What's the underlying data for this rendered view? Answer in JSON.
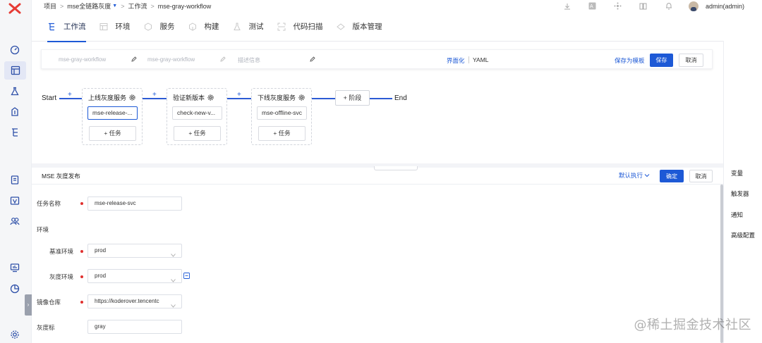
{
  "breadcrumb": {
    "project_label": "项目",
    "project_name": "mse全链路灰度",
    "section": "工作流",
    "workflow": "mse-gray-workflow"
  },
  "user": {
    "name": "admin(admin)"
  },
  "tabs": [
    {
      "label": "工作流",
      "icon": "workflow-icon"
    },
    {
      "label": "环境",
      "icon": "environment-icon"
    },
    {
      "label": "服务",
      "icon": "service-icon"
    },
    {
      "label": "构建",
      "icon": "build-icon"
    },
    {
      "label": "测试",
      "icon": "test-icon"
    },
    {
      "label": "代码扫描",
      "icon": "scan-icon"
    },
    {
      "label": "版本管理",
      "icon": "version-icon"
    }
  ],
  "workflow_header": {
    "name_placeholder": "mse-gray-workflow",
    "display_name_placeholder": "mse-gray-workflow",
    "description_placeholder": "描述信息",
    "mode_ui": "界面化",
    "mode_yaml": "YAML",
    "save_as_template": "保存为模板",
    "save": "保存",
    "cancel": "取消"
  },
  "pipeline": {
    "start": "Start",
    "end": "End",
    "add_stage": "+ 阶段",
    "add_task": "+ 任务",
    "plus": "+",
    "stages": [
      {
        "name": "上线灰度服务",
        "job": "mse-release-..."
      },
      {
        "name": "验证新版本",
        "job": "check-new-v..."
      },
      {
        "name": "下线灰度服务",
        "job": "mse-offline-svc"
      }
    ]
  },
  "task_panel": {
    "title": "MSE 灰度发布",
    "run_policy": "默认执行",
    "confirm": "确定",
    "cancel": "取消",
    "fields": {
      "task_name_label": "任务名称",
      "task_name_value": "mse-release-svc",
      "env_section": "环境",
      "base_env_label": "基准环境",
      "base_env_value": "prod",
      "gray_env_label": "灰度环境",
      "gray_env_value": "prod",
      "registry_label": "镜像仓库",
      "registry_value": "https://koderover.tencentc",
      "gray_tag_label": "灰度标",
      "gray_tag_value": "gray"
    }
  },
  "right_panel": {
    "items": [
      "变量",
      "触发器",
      "通知",
      "高级配置"
    ]
  },
  "watermark": "@稀土掘金技术社区",
  "colors": {
    "primary": "#1d59d6",
    "required": "#e0302f",
    "brand": "#e63b35"
  }
}
